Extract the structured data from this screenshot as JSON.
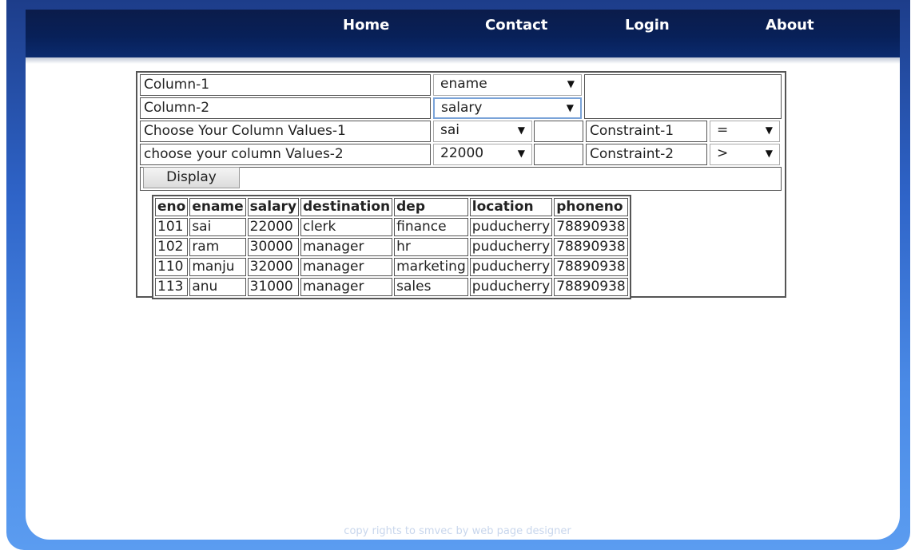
{
  "nav": {
    "items": [
      {
        "label": "Home"
      },
      {
        "label": "Contact"
      },
      {
        "label": "Login"
      },
      {
        "label": "About"
      }
    ]
  },
  "form": {
    "rows": {
      "col1": {
        "label": "Column-1",
        "selected": "ename"
      },
      "col2": {
        "label": "Column-2",
        "selected": "salary"
      },
      "val1": {
        "label": "Choose Your Column Values-1",
        "selected": "sai",
        "constraint_label": "Constraint-1",
        "constraint": "="
      },
      "val2": {
        "label": "choose your column Values-2",
        "selected": "22000",
        "constraint_label": "Constraint-2",
        "constraint": ">"
      }
    },
    "display_button": "Display"
  },
  "results": {
    "columns": [
      "eno",
      "ename",
      "salary",
      "destination",
      "dep",
      "location",
      "phoneno"
    ],
    "rows": [
      [
        "101",
        "sai",
        "22000",
        "clerk",
        "finance",
        "puducherry",
        "78890938"
      ],
      [
        "102",
        "ram",
        "30000",
        "manager",
        "hr",
        "puducherry",
        "78890938"
      ],
      [
        "110",
        "manju",
        "32000",
        "manager",
        "marketing",
        "puducherry",
        "78890938"
      ],
      [
        "113",
        "anu",
        "31000",
        "manager",
        "sales",
        "puducherry",
        "78890938"
      ]
    ]
  },
  "footer": "copy rights to smvec by web page designer",
  "icons": {
    "dropdown": "dropdown-arrow-icon"
  }
}
